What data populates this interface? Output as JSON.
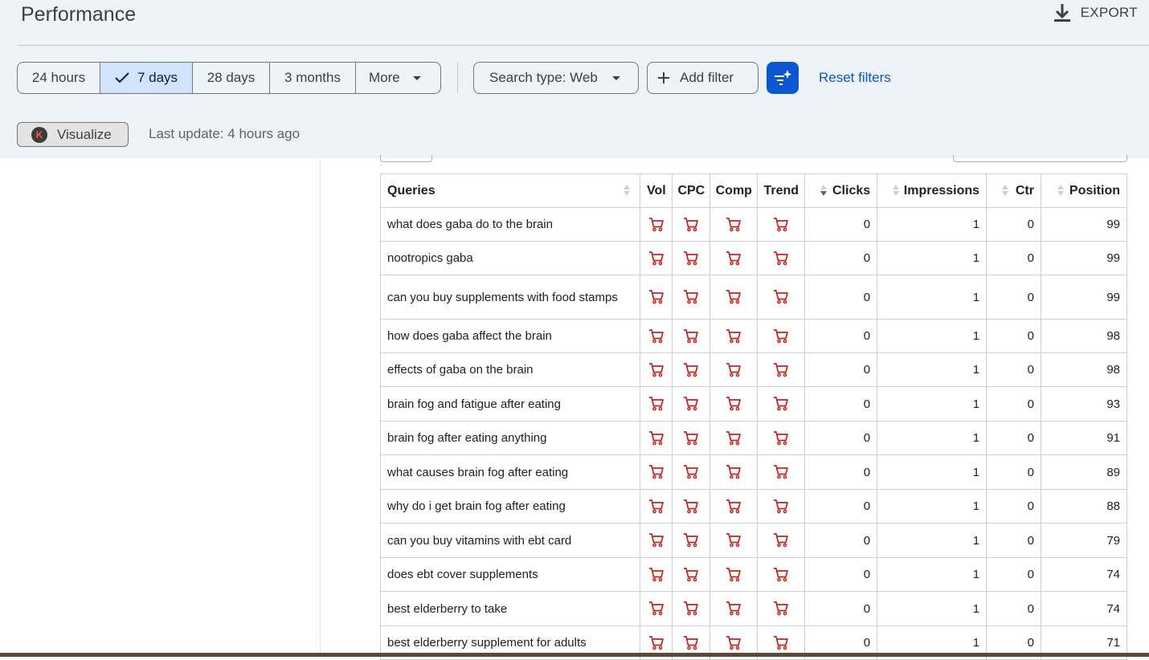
{
  "page": {
    "title": "Performance",
    "export_label": "EXPORT"
  },
  "date_ranges": [
    {
      "label": "24 hours",
      "selected": false
    },
    {
      "label": "7 days",
      "selected": true
    },
    {
      "label": "28 days",
      "selected": false
    },
    {
      "label": "3 months",
      "selected": false
    },
    {
      "label": "More",
      "selected": false
    }
  ],
  "filters": {
    "search_type_label": "Search type: Web",
    "add_filter_label": "Add filter",
    "reset_label": "Reset filters"
  },
  "toolbar": {
    "visualize_label": "Visualize",
    "visualize_logo_letter": "K",
    "last_update": "Last update: 4 hours ago"
  },
  "colors": {
    "accent": "#0b57d0",
    "selected_segment": "#d3e3fd",
    "header_bg": "#eef2f9",
    "cart_icon": "#c5221f"
  },
  "table": {
    "columns": [
      "Queries",
      "Vol",
      "CPC",
      "Comp",
      "Trend",
      "Clicks",
      "Impressions",
      "Ctr",
      "Position"
    ],
    "sorted_column": "Clicks",
    "rows": [
      {
        "query": "what does gaba do to the brain",
        "clicks": "0",
        "impressions": "1",
        "ctr": "0",
        "position": "99"
      },
      {
        "query": "nootropics gaba",
        "clicks": "0",
        "impressions": "1",
        "ctr": "0",
        "position": "99"
      },
      {
        "query": "can you buy supplements with food stamps",
        "clicks": "0",
        "impressions": "1",
        "ctr": "0",
        "position": "99"
      },
      {
        "query": "how does gaba affect the brain",
        "clicks": "0",
        "impressions": "1",
        "ctr": "0",
        "position": "98"
      },
      {
        "query": "effects of gaba on the brain",
        "clicks": "0",
        "impressions": "1",
        "ctr": "0",
        "position": "98"
      },
      {
        "query": "brain fog and fatigue after eating",
        "clicks": "0",
        "impressions": "1",
        "ctr": "0",
        "position": "93"
      },
      {
        "query": "brain fog after eating anything",
        "clicks": "0",
        "impressions": "1",
        "ctr": "0",
        "position": "91"
      },
      {
        "query": "what causes brain fog after eating",
        "clicks": "0",
        "impressions": "1",
        "ctr": "0",
        "position": "89"
      },
      {
        "query": "why do i get brain fog after eating",
        "clicks": "0",
        "impressions": "1",
        "ctr": "0",
        "position": "88"
      },
      {
        "query": "can you buy vitamins with ebt card",
        "clicks": "0",
        "impressions": "1",
        "ctr": "0",
        "position": "79"
      },
      {
        "query": "does ebt cover supplements",
        "clicks": "0",
        "impressions": "1",
        "ctr": "0",
        "position": "74"
      },
      {
        "query": "best elderberry to take",
        "clicks": "0",
        "impressions": "1",
        "ctr": "0",
        "position": "74"
      },
      {
        "query": "best elderberry supplement for adults",
        "clicks": "0",
        "impressions": "1",
        "ctr": "0",
        "position": "71"
      }
    ]
  }
}
